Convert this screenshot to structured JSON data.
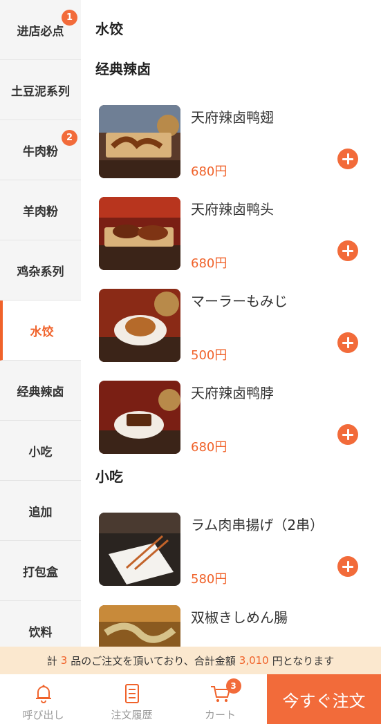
{
  "sidebar": {
    "items": [
      {
        "label": "进店必点",
        "badge": "1"
      },
      {
        "label": "土豆泥系列",
        "badge": ""
      },
      {
        "label": "牛肉粉",
        "badge": "2"
      },
      {
        "label": "羊肉粉",
        "badge": ""
      },
      {
        "label": "鸡杂系列",
        "badge": ""
      },
      {
        "label": "水饺",
        "badge": "",
        "active": true
      },
      {
        "label": "经典辣卤",
        "badge": ""
      },
      {
        "label": "小吃",
        "badge": ""
      },
      {
        "label": "追加",
        "badge": ""
      },
      {
        "label": "打包盒",
        "badge": ""
      },
      {
        "label": "饮料",
        "badge": ""
      }
    ]
  },
  "main": {
    "sections": [
      {
        "title": "水饺",
        "items": []
      },
      {
        "title": "经典辣卤",
        "items": [
          {
            "name": "天府辣卤鸭翅",
            "price": "680円"
          },
          {
            "name": "天府辣卤鸭头",
            "price": "680円"
          },
          {
            "name": "マーラーもみじ",
            "price": "500円"
          },
          {
            "name": "天府辣卤鸭脖",
            "price": "680円"
          }
        ]
      },
      {
        "title": "小吃",
        "items": [
          {
            "name": "ラム肉串揚げ（2串）",
            "price": "580円"
          },
          {
            "name": "双椒きしめん腸",
            "price": ""
          }
        ]
      }
    ]
  },
  "summary": {
    "prefix": "計",
    "count": "3",
    "middle": "品のご注文を頂いており、合計金額",
    "total": "3,010",
    "suffix": "円となります"
  },
  "bottom_nav": {
    "call_label": "呼び出し",
    "history_label": "注文履歴",
    "cart_label": "カート",
    "cart_count": "3",
    "order_label": "今すぐ注文"
  },
  "colors": {
    "accent": "#f0622a",
    "summary_bg": "#fbe8cf",
    "sidebar_bg": "#f5f5f5"
  },
  "icons": [
    "bell-icon",
    "receipt-icon",
    "cart-icon",
    "plus-icon"
  ]
}
